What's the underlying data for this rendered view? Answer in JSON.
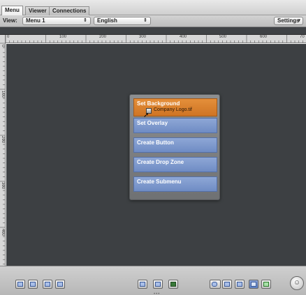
{
  "tabs": [
    {
      "label": "Menu",
      "active": true
    },
    {
      "label": "Viewer",
      "active": false
    },
    {
      "label": "Connections",
      "active": false
    }
  ],
  "toolbar": {
    "view_label": "View:",
    "menu_select": "Menu 1",
    "language_select": "English",
    "settings_button": "Settings"
  },
  "ruler": {
    "top_ticks": [
      "0",
      "100",
      "200",
      "300",
      "400",
      "500",
      "600",
      "70"
    ],
    "left_ticks": [
      "0",
      "100",
      "200",
      "300",
      "400"
    ]
  },
  "menu": {
    "buttons": [
      {
        "label": "Set Background",
        "sub": "Company Logo.tif",
        "active": true
      },
      {
        "label": "Set Overlay",
        "active": false
      },
      {
        "label": "Create Button",
        "active": false
      },
      {
        "label": "Create Drop Zone",
        "active": false
      },
      {
        "label": "Create Submenu",
        "active": false
      }
    ]
  },
  "icons": {
    "popup_arrow": "updown-arrow-icon",
    "settings_arrow": "chevron-down-icon",
    "cursor": "cursor-arrow-icon",
    "file": "image-file-icon",
    "round_button": "person-icon"
  },
  "colors": {
    "canvas": "#3d4043",
    "active_button": "#d9802e",
    "menu_button": "#7f99cd"
  }
}
